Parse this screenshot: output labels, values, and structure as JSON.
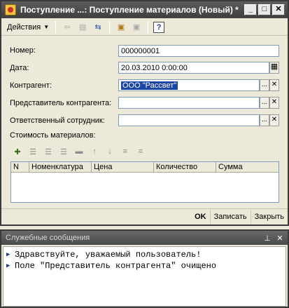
{
  "window": {
    "title": "Поступление ...: Поступление материалов (Новый) *",
    "buttons": {
      "minimize": "_",
      "maximize": "□",
      "close": "✕"
    }
  },
  "toolbar": {
    "actions_label": "Действия",
    "icons": [
      "back-icon",
      "doc-icon",
      "swap-icon",
      "post-icon",
      "unpost-icon",
      "help-icon"
    ],
    "help_glyph": "?"
  },
  "form": {
    "number": {
      "label": "Номер:",
      "value": "000000001"
    },
    "date": {
      "label": "Дата:",
      "value": "20.03.2010  0:00:00"
    },
    "contractor": {
      "label": "Контрагент:",
      "value": "ООО \"Рассвет\""
    },
    "contractor_rep": {
      "label": "Представитель контрагента:",
      "value": ""
    },
    "responsible": {
      "label": "Ответственный сотрудник:",
      "value": ""
    },
    "choose_glyph": "...",
    "clear_glyph": "✕"
  },
  "materials": {
    "label": "Стоимость материалов:",
    "columns": [
      "N",
      "Номенклатура",
      "Цена",
      "Количество",
      "Сумма"
    ]
  },
  "bottom": {
    "ok": "OK",
    "save": "Записать",
    "close": "Закрыть"
  },
  "messages": {
    "title": "Служебные сообщения",
    "lines": [
      "Здравствуйте, уважаемый пользователь!",
      "Поле \"Представитель контрагента\" очищено"
    ]
  }
}
